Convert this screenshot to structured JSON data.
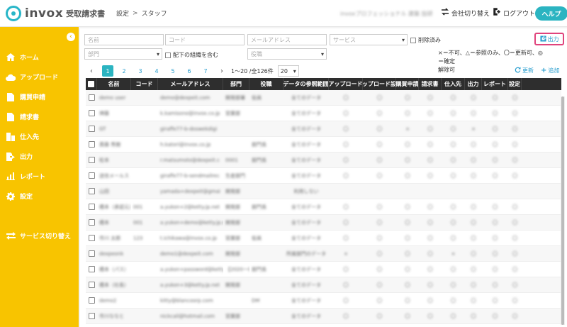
{
  "header": {
    "logo_text": "invox",
    "logo_sub": "受取請求書",
    "breadcrumb": [
      "設定",
      "スタッフ"
    ],
    "breadcrumb_sep": ">",
    "company": "invoxプロフェッショナル 建築 技研",
    "switch_company": "会社切り替え",
    "logout": "ログアウト",
    "help": "ヘルプ"
  },
  "sidebar": {
    "collapse": "‹",
    "items": [
      {
        "label": "ホーム",
        "icon": "home-icon"
      },
      {
        "label": "アップロード",
        "icon": "cloud-upload-icon"
      },
      {
        "label": "購買申請",
        "icon": "document-icon"
      },
      {
        "label": "請求書",
        "icon": "invoice-icon"
      },
      {
        "label": "仕入先",
        "icon": "building-icon"
      },
      {
        "label": "出力",
        "icon": "file-export-icon"
      },
      {
        "label": "レポート",
        "icon": "bar-chart-icon"
      },
      {
        "label": "設定",
        "icon": "gear-icon"
      },
      {
        "label": "サービス切り替え",
        "icon": "switch-icon"
      }
    ]
  },
  "filters": {
    "name": "名前",
    "code": "コード",
    "email": "メールアドレス",
    "service": "サービス",
    "deleted": "削除済み",
    "department": "部門",
    "include_sub": "配下の組織を含む",
    "position": "役職",
    "export": "出力",
    "legend_1": "×＝不可、△＝参照のみ、〇＝更新可、◎＝確定",
    "legend_2": "解除可"
  },
  "pager": {
    "prev": "‹",
    "pages": [
      "1",
      "2",
      "3",
      "4",
      "5",
      "6",
      "7"
    ],
    "next": "›",
    "range": "1〜20 /全126件",
    "per_page": "20",
    "refresh": "更新",
    "add": "追加"
  },
  "table": {
    "columns": [
      "名前",
      "コード",
      "メールアドレス",
      "部門",
      "役職",
      "データの参照範囲",
      "アップロード",
      "アップロード設定",
      "購買申請",
      "請求書",
      "仕入先",
      "出力",
      "レポート",
      "設定"
    ],
    "rows": [
      [
        "demo user",
        "",
        "demo@dexpeit.com",
        "開発部署",
        "役員",
        "全てのデータ",
        "〇",
        "〇",
        "〇",
        "〇",
        "〇",
        "〇",
        "〇",
        "〇"
      ],
      [
        "神藤",
        "",
        "k.kamisono@invox.co.jp",
        "営業部",
        "",
        "全てのデータ",
        "〇",
        "〇",
        "〇",
        "〇",
        "〇",
        "〇",
        "〇",
        "〇"
      ],
      [
        "GT",
        "",
        "giraffe77-b-doswekdigi",
        "",
        "",
        "全てのデータ",
        "〇",
        "〇",
        "×",
        "〇",
        "〇",
        "×",
        "〇",
        "〇"
      ],
      [
        "斎藤 秀樹",
        "",
        "h.katori@invox.co.jp",
        "",
        "部門長",
        "全てのデータ",
        "〇",
        "〇",
        "〇",
        "〇",
        "〇",
        "〇",
        "〇",
        "〇"
      ],
      [
        "松本",
        "",
        "r.matsumoto@dexpeit.c",
        "0001",
        "部門長",
        "全てのデータ",
        "〇",
        "〇",
        "〇",
        "〇",
        "〇",
        "〇",
        "〇",
        "〇"
      ],
      [
        "送信メールス",
        "",
        "giraffe77-b-sendmailrec",
        "生産部門",
        "",
        "全てのデータ",
        "〇",
        "〇",
        "〇",
        "〇",
        "〇",
        "〇",
        "〇",
        "〇"
      ],
      [
        "山田",
        "",
        "yamada+dexpeit@gmai",
        "開発部",
        "",
        "利用しない",
        "",
        "",
        "",
        "",
        "",
        "",
        "",
        ""
      ],
      [
        "橋本（承認元）",
        "001",
        "a.yukon+2@ketty.jp.net",
        "開発部",
        "部門長",
        "全てのデータ",
        "〇",
        "〇",
        "〇",
        "〇",
        "〇",
        "〇",
        "〇",
        "〇"
      ],
      [
        "橋本",
        "001",
        "a.yukon+demo@ketty.jp.net",
        "開発部",
        "",
        "全てのデータ",
        "〇",
        "〇",
        "〇",
        "〇",
        "〇",
        "〇",
        "〇",
        "〇"
      ],
      [
        "市川 太郎",
        "123",
        "t.ichikawa@invox.co.jp",
        "営業部",
        "役員",
        "全てのデータ",
        "〇",
        "〇",
        "〇",
        "〇",
        "〇",
        "〇",
        "〇",
        "〇"
      ],
      [
        "dexpeonk",
        "",
        "demo1@dexpeit.com",
        "開発部",
        "",
        "所属部門のデータ",
        "×",
        "〇",
        "〇",
        "〇",
        "×",
        "〇",
        "〇",
        "〇"
      ],
      [
        "橋本（パス）",
        "",
        "a.yukon+password@ketty",
        "【2020ー01",
        "部門長",
        "全てのデータ",
        "〇",
        "〇",
        "〇",
        "〇",
        "〇",
        "〇",
        "〇",
        "〇"
      ],
      [
        "橋本（社長）",
        "",
        "a.yukon+3@ketty.jp.net",
        "開発部",
        "",
        "全てのデータ",
        "〇",
        "〇",
        "〇",
        "〇",
        "〇",
        "〇",
        "〇",
        "〇"
      ],
      [
        "demo2",
        "",
        "kitty@blancoorp.com",
        "",
        "DM",
        "全てのデータ",
        "〇",
        "〇",
        "〇",
        "〇",
        "〇",
        "〇",
        "〇",
        "〇"
      ],
      [
        "市川ななと",
        "",
        "nickcali@hotmail.com",
        "営業部",
        "",
        "全てのデータ",
        "〇",
        "〇",
        "〇",
        "〇",
        "〇",
        "〇",
        "〇",
        "〇"
      ]
    ]
  },
  "colors": {
    "sidebar": "#f8c400",
    "accent": "#2bb4c1",
    "link": "#2b9fcf",
    "highlight": "#e0437c"
  }
}
